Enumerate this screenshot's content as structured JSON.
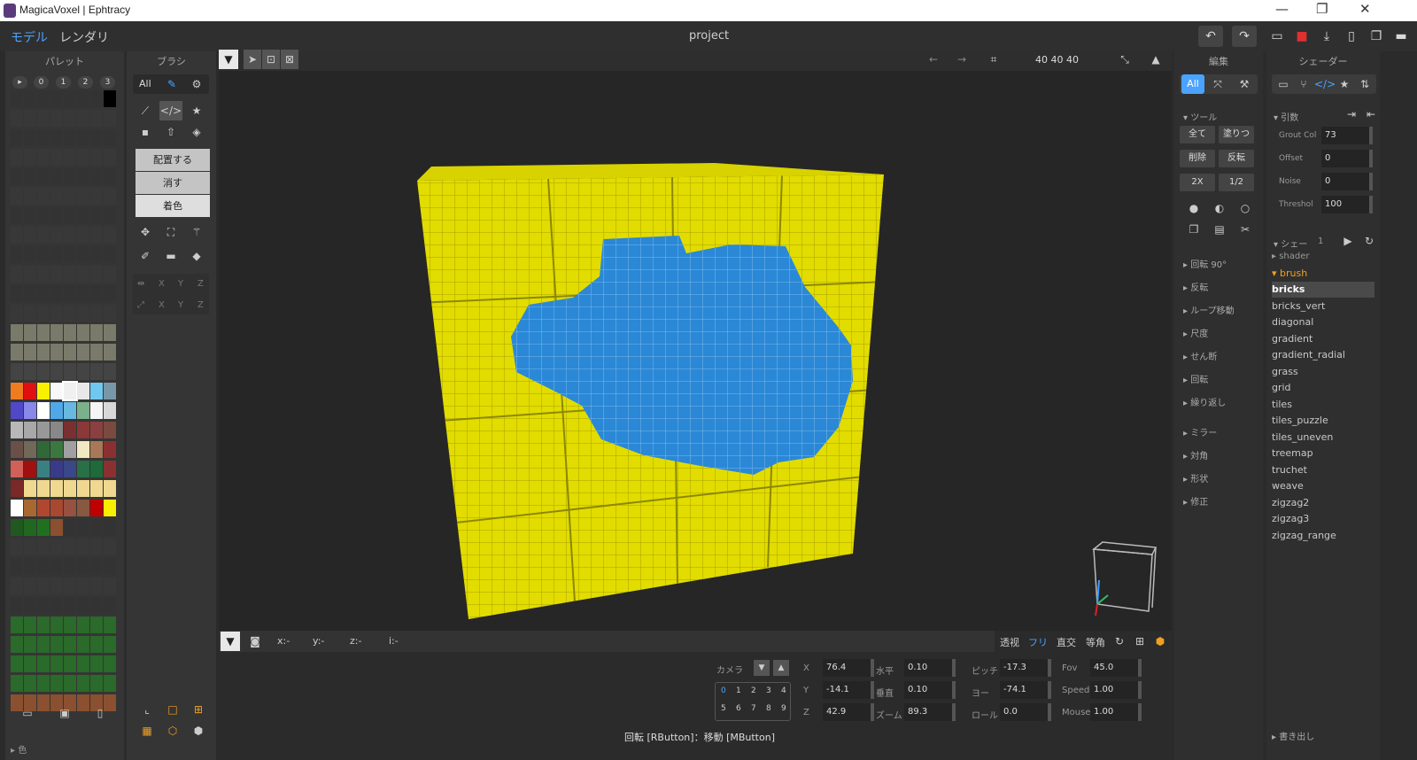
{
  "window": {
    "title": "MagicaVoxel | Ephtracy",
    "min": "—",
    "restore": "❐",
    "close": "✕"
  },
  "menu": {
    "model_tab": "モデル",
    "render_tab": "レンダリ",
    "project_name": "project"
  },
  "palette": {
    "title": "パレット",
    "pages": [
      "▸",
      "0",
      "1",
      "2",
      "3"
    ],
    "footer_label": "▸ 色",
    "colors": [
      "#f07c20",
      "#e01010",
      "#f8f000",
      "#f8f8f8",
      "#f0f0f0",
      "#e8e8e8",
      "#70c8f0",
      "#7898a8",
      "#5048c8",
      "#8888e8",
      "#ffffff",
      "#50a8e8",
      "#68b8e0",
      "#7ab08a",
      "#f5f5f5",
      "#d8d8d8",
      "#b8b8b8",
      "#a8a8a8",
      "#989898",
      "#888888",
      "#7a3030",
      "#8a3838",
      "#8a4040",
      "#7a4a40",
      "#6a5048",
      "#706858",
      "#306838",
      "#3a7840",
      "#a0a0a0",
      "#f0e8c0",
      "#a87858",
      "#8a3030",
      "#d06058",
      "#a01010",
      "#3a8080",
      "#3a3a8a",
      "#3a4888",
      "#287048",
      "#1e6a38",
      "#8a3030",
      "#7a2828",
      "#f0d890",
      "#f0d890",
      "#f0d890",
      "#f0d890",
      "#f0d890",
      "#f0d890",
      "#f0d890",
      "#ffffff",
      "#a86830",
      "#b04830",
      "#a84830",
      "#985040",
      "#885840",
      "#c00000",
      "#f8f000",
      "#205820",
      "#206820",
      "#207020",
      "#8a5030"
    ]
  },
  "brush": {
    "title": "ブラシ",
    "all": "All",
    "attach": "配置する",
    "erase": "消す",
    "paint": "着色",
    "axes": [
      "X",
      "Y",
      "Z"
    ]
  },
  "viewport": {
    "dims": "40  40  40",
    "coords": [
      "x:-",
      "y:-",
      "z:-",
      "i:-"
    ],
    "hint": "回転 [RButton]：移動 [MButton]"
  },
  "view_modes": [
    "透视",
    "フリ",
    "直交",
    "等角"
  ],
  "camera": {
    "label": "カメラ",
    "slots": [
      "0",
      "1",
      "2",
      "3",
      "4",
      "5",
      "6",
      "7",
      "8",
      "9"
    ],
    "fields": [
      {
        "label": "X",
        "value": "76.4"
      },
      {
        "label": "Y",
        "value": "-14.1"
      },
      {
        "label": "Z",
        "value": "42.9"
      },
      {
        "label": "水平",
        "value": "0.10"
      },
      {
        "label": "垂直",
        "value": "0.10"
      },
      {
        "label": "ズーム",
        "value": "89.3"
      },
      {
        "label": "ピッチ",
        "value": "-17.3"
      },
      {
        "label": "ヨー",
        "value": "-74.1"
      },
      {
        "label": "ロール",
        "value": "0.0"
      },
      {
        "label": "Fov",
        "value": "45.0"
      },
      {
        "label": "Speed",
        "value": "1.00"
      },
      {
        "label": "Mouse",
        "value": "1.00"
      }
    ]
  },
  "edit": {
    "title": "編集",
    "all": "All",
    "tool_section": "▾ ツール",
    "buttons": [
      "全て",
      "塗りつ",
      "削除",
      "反転",
      "2X",
      "1/2"
    ],
    "sections": [
      "▸ 回転 90°",
      "▸ 反転",
      "▸ ループ移動",
      "▸ 尺度",
      "▸ せん断",
      "▸ 回転",
      "▸ 繰り返し",
      "▸ ミラー",
      "▸ 対角",
      "▸ 形状",
      "▸ 修正"
    ]
  },
  "shader": {
    "title": "シェーダー",
    "args_section": "▾ 引数",
    "params": [
      {
        "label": "Grout Col",
        "value": "73"
      },
      {
        "label": "Offset",
        "value": "0"
      },
      {
        "label": "Noise",
        "value": "0"
      },
      {
        "label": "Threshol",
        "value": "100"
      }
    ],
    "list_section": "▾ シェー",
    "list_count": "1",
    "folders": [
      "▸ shader",
      "▾ brush"
    ],
    "items": [
      "bricks",
      "bricks_vert",
      "diagonal",
      "gradient",
      "gradient_radial",
      "grass",
      "grid",
      "tiles",
      "tiles_puzzle",
      "tiles_uneven",
      "treemap",
      "truchet",
      "weave",
      "zigzag2",
      "zigzag3",
      "zigzag_range"
    ],
    "selected": "bricks",
    "export": "▸ 書き出し"
  },
  "colors": {
    "accent": "#4aa3ff",
    "voxel_yellow": "#e8e000",
    "voxel_blue": "#2888d8"
  }
}
